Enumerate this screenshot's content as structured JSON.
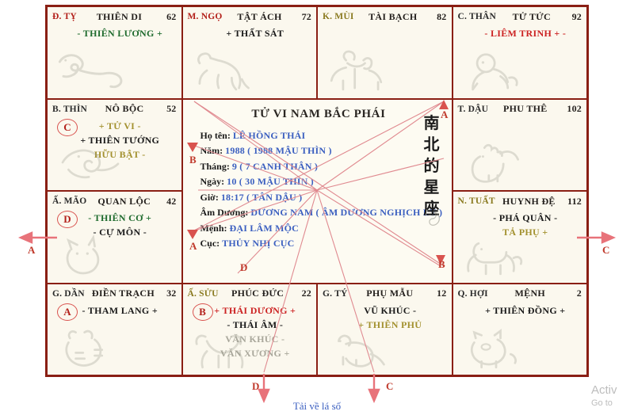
{
  "chart": {
    "title": "TỬ VI NAM BẮC PHÁI",
    "chinese_title": [
      "南",
      "北",
      "的",
      "星",
      "座"
    ],
    "info": [
      {
        "label": "Họ tên:",
        "value": "LÊ HỒNG THÁI"
      },
      {
        "label": "Năm:",
        "value": "1988 ( 1988 MẬU THÌN )"
      },
      {
        "label": "Tháng:",
        "value": "9 ( 7 CANH THÂN )"
      },
      {
        "label": "Ngày:",
        "value": "10 ( 30 MẬU THÌN )"
      },
      {
        "label": "Giờ:",
        "value": "18:17 ( TÂN DẬU )"
      },
      {
        "label": "Âm Dương:",
        "value": "DƯƠNG NAM ( ÂM DƯƠNG NGHỊCH LÝ )"
      },
      {
        "label": "Mệnh:",
        "value": "ĐẠI LÂM MỘC"
      },
      {
        "label": "Cục:",
        "value": "THỦY NHỊ CỤC"
      }
    ],
    "cells": [
      {
        "id": "cell-ty",
        "chi": "Đ. TỴ",
        "chi_color": "red",
        "palace": "THIÊN DI",
        "age": "62",
        "marker": null,
        "animal": "snake-icon",
        "stars": [
          {
            "text": "- THIÊN LƯƠNG +",
            "color": "green"
          }
        ]
      },
      {
        "id": "cell-ngo",
        "chi": "M. NGỌ",
        "chi_color": "red",
        "palace": "TẬT ÁCH",
        "age": "72",
        "marker": null,
        "animal": "horse-icon",
        "stars": [
          {
            "text": "+ THẤT SÁT",
            "color": "dark"
          }
        ]
      },
      {
        "id": "cell-mui",
        "chi": "K. MÙI",
        "chi_color": "olive",
        "palace": "TÀI BẠCH",
        "age": "82",
        "marker": null,
        "animal": "goat-icon",
        "stars": []
      },
      {
        "id": "cell-than",
        "chi": "C. THÂN",
        "chi_color": "dark",
        "palace": "TỬ TỨC",
        "age": "92",
        "marker": null,
        "animal": "monkey-icon",
        "stars": [
          {
            "text": "- LIÊM TRINH + -",
            "color": "red"
          }
        ]
      },
      {
        "id": "cell-thin",
        "chi": "B. THÌN",
        "chi_color": "dark",
        "palace": "NÔ BỘC",
        "age": "52",
        "marker": "C",
        "animal": "dragon-icon",
        "stars": [
          {
            "text": "+ TỬ VI -",
            "color": "olive"
          },
          {
            "text": "+ THIÊN TƯỚNG",
            "color": "dark"
          },
          {
            "text": "HỮU BẬT -",
            "color": "olive"
          }
        ]
      },
      {
        "id": "cell-dau",
        "chi": "T. DẬU",
        "chi_color": "dark",
        "palace": "PHU THÊ",
        "age": "102",
        "marker": null,
        "animal": "rooster-icon",
        "stars": []
      },
      {
        "id": "cell-mao",
        "chi": "Ấ. MÃO",
        "chi_color": "dark",
        "palace": "QUAN LỘC",
        "age": "42",
        "marker": "D",
        "animal": "cat-icon",
        "stars": [
          {
            "text": "- THIÊN CƠ +",
            "color": "green"
          },
          {
            "text": "- CỰ MÔN -",
            "color": "dark"
          }
        ]
      },
      {
        "id": "cell-tuat",
        "chi": "N. TUẤT",
        "chi_color": "olive",
        "palace": "HUYNH ĐỆ",
        "age": "112",
        "marker": null,
        "animal": "dog-icon",
        "stars": [
          {
            "text": "- PHÁ QUÂN -",
            "color": "dark"
          },
          {
            "text": "TẢ PHỤ +",
            "color": "olive"
          }
        ]
      },
      {
        "id": "cell-dan",
        "chi": "G. DẦN",
        "chi_color": "dark",
        "palace": "ĐIỀN TRẠCH",
        "age": "32",
        "marker": "A",
        "animal": "tiger-icon",
        "stars": [
          {
            "text": "- THAM LANG +",
            "color": "dark"
          }
        ]
      },
      {
        "id": "cell-suu",
        "chi": "Ấ. SỬU",
        "chi_color": "olive",
        "palace": "PHÚC ĐỨC",
        "age": "22",
        "marker": "B",
        "animal": "ox-icon",
        "stars": [
          {
            "text": "+ THÁI DƯƠNG +",
            "color": "red"
          },
          {
            "text": "- THÁI ÂM -",
            "color": "dark"
          },
          {
            "text": "VĂN KHÚC -",
            "color": "gray"
          },
          {
            "text": "VĂN XƯƠNG +",
            "color": "gray"
          }
        ]
      },
      {
        "id": "cell-tytiny",
        "chi": "G. TÝ",
        "chi_color": "dark",
        "palace": "PHỤ MẪU",
        "age": "12",
        "marker": null,
        "animal": "rat-icon",
        "stars": [
          {
            "text": "VŨ KHÚC -",
            "color": "dark"
          },
          {
            "text": "+ THIÊN PHỦ",
            "color": "olive"
          }
        ]
      },
      {
        "id": "cell-hoi",
        "chi": "Q. HỢI",
        "chi_color": "dark",
        "palace": "MỆNH",
        "age": "2",
        "marker": null,
        "animal": "pig-icon",
        "stars": [
          {
            "text": "+ THIÊN ĐỒNG +",
            "color": "dark"
          }
        ]
      }
    ],
    "arrow_labels": [
      {
        "id": "label-a-left",
        "text": "A"
      },
      {
        "id": "label-c-right",
        "text": "C"
      },
      {
        "id": "label-b-center",
        "text": "B"
      },
      {
        "id": "label-a-center",
        "text": "A"
      },
      {
        "id": "label-a-topright",
        "text": "A"
      },
      {
        "id": "label-b-botright",
        "text": "B"
      },
      {
        "id": "label-d-bottom",
        "text": "D"
      },
      {
        "id": "label-c-bottom",
        "text": "C"
      },
      {
        "id": "label-d-center",
        "text": "D"
      }
    ]
  },
  "footer": {
    "download_link": "Tải về lá số"
  },
  "watermark": {
    "line1": "Activ",
    "line2": "Go to"
  },
  "colors": {
    "frame": "#8a1f14",
    "paper": "#fbf8ee",
    "accent_red": "#b3201a",
    "link_blue": "#3b5fc0",
    "star_green": "#1f6b2e",
    "star_olive": "#a3912f",
    "arrow_pink": "#e8737a"
  }
}
